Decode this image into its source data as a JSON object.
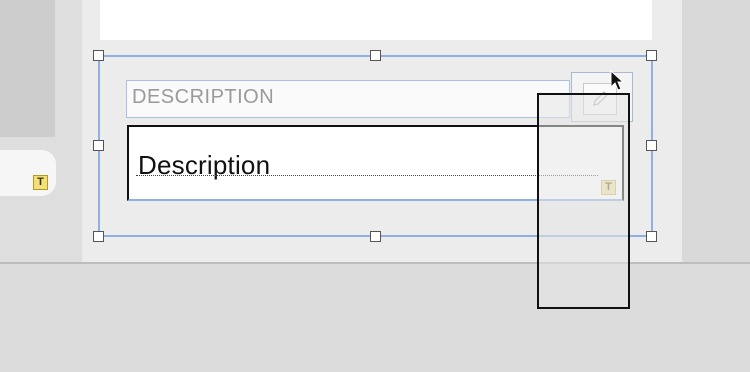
{
  "field": {
    "label": "DESCRIPTION",
    "value": "Description"
  },
  "icons": {
    "text_marker": "T",
    "edit": "pencil-icon",
    "pointer": "mouse-pointer-icon"
  },
  "colors": {
    "selection": "#8fb0e3",
    "marker_fill": "#f3e07a"
  }
}
